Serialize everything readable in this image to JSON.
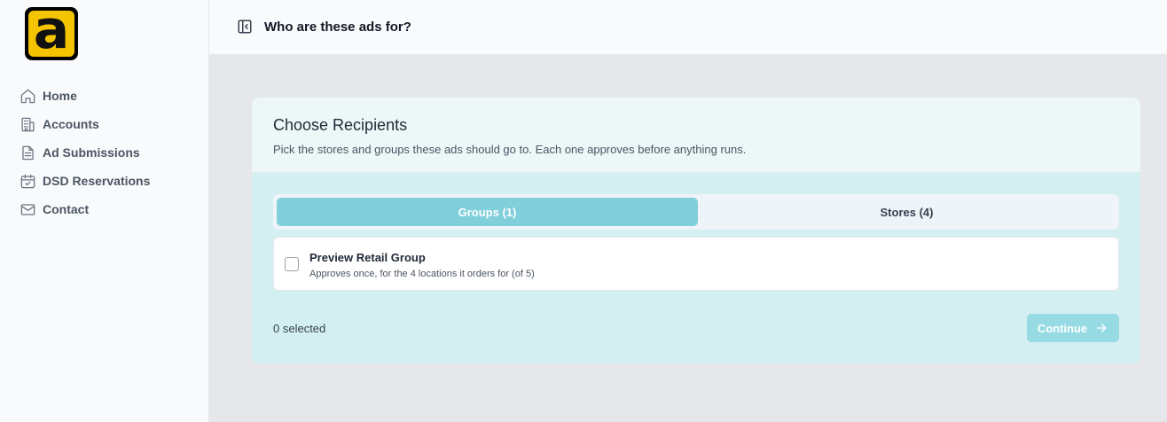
{
  "brand": {
    "logo_letter": "a",
    "accent": "#f5c400"
  },
  "sidebar": {
    "items": [
      {
        "label": "Home",
        "icon": "home-icon"
      },
      {
        "label": "Accounts",
        "icon": "building-icon"
      },
      {
        "label": "Ad Submissions",
        "icon": "document-icon"
      },
      {
        "label": "DSD Reservations",
        "icon": "calendar-check-icon"
      },
      {
        "label": "Contact",
        "icon": "mail-icon"
      }
    ]
  },
  "header": {
    "title": "Who are these ads for?",
    "toggle_icon": "sidebar-collapse-icon"
  },
  "card": {
    "title": "Choose Recipients",
    "subtitle": "Pick the stores and groups these ads should go to. Each one approves before anything runs.",
    "tabs": [
      {
        "label": "Groups (1)",
        "active": true
      },
      {
        "label": "Stores (4)",
        "active": false
      }
    ],
    "groups": [
      {
        "name": "Preview Retail Group",
        "description": "Approves once, for the 4 locations it orders for (of 5)",
        "checked": false
      }
    ],
    "selected_text": "0 selected",
    "continue_label": "Continue",
    "colors": {
      "tab_active": "#82cfdc",
      "continue_disabled": "#96dbe4",
      "panel": "#d3eff2"
    }
  }
}
